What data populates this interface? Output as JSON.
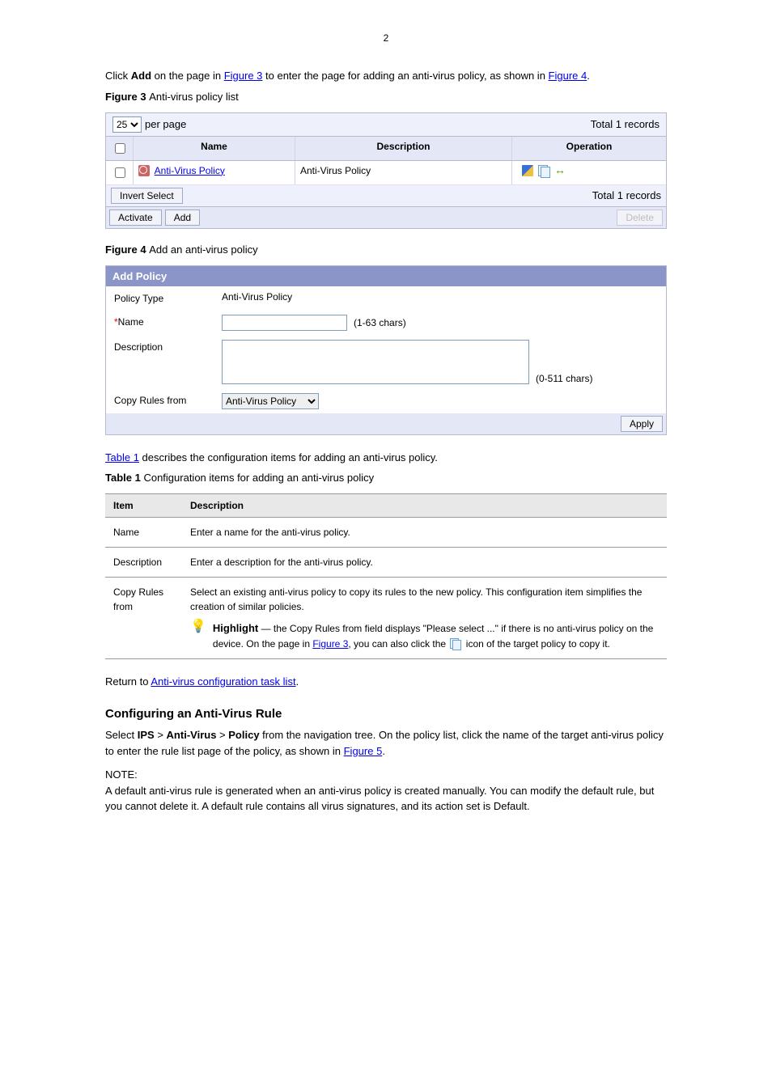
{
  "page_number": "2",
  "intro": {
    "line1_prefix": "Click ",
    "line1_bold": "Add",
    "line1_suffix": " on the page in ",
    "figure3_link": "Figure 3",
    "line1_end": " to enter the page for adding an anti-virus policy, as shown in ",
    "figure4_link_a": "Figure 4",
    "intro_end": "."
  },
  "fig3": {
    "caption_prefix": "Figure 3 ",
    "caption": "Anti-virus policy list",
    "perpage_value": "25",
    "perpage_label": "per page",
    "total_top": "Total 1 records",
    "th_name": "Name",
    "th_desc": "Description",
    "th_op": "Operation",
    "row_name": "Anti-Virus Policy",
    "row_desc": "Anti-Virus Policy",
    "invert_btn": "Invert Select",
    "total_bottom": "Total 1 records",
    "activate_btn": "Activate",
    "add_btn": "Add",
    "delete_btn": "Delete"
  },
  "fig4": {
    "caption_prefix": "Figure 4 ",
    "caption": "Add an anti-virus policy",
    "header": "Add Policy",
    "policy_type_label": "Policy Type",
    "policy_type_value": "Anti-Virus Policy",
    "name_label": "Name",
    "name_hint": "(1-63  chars)",
    "desc_label": "Description",
    "desc_hint": "(0-511  chars)",
    "copy_label": "Copy Rules from",
    "copy_value": "Anti-Virus Policy",
    "apply_btn": "Apply"
  },
  "tab1": {
    "caption_link": "Table 1",
    "caption_rest": " describes the configuration items for adding an anti-virus policy.",
    "full_caption_prefix": "Table 1 ",
    "full_caption": "Configuration items for adding an anti-virus policy",
    "th_item": "Item",
    "th_desc": "Description",
    "r1_item": "Name",
    "r1_desc": "Enter a name for the anti-virus policy.",
    "r2_item": "Description",
    "r2_desc": "Enter a description for the anti-virus policy.",
    "r3_item": "Copy Rules from",
    "r3_desc_line1": "Select an existing anti-virus policy to copy its rules to the new policy. This configuration item simplifies the creation of similar policies.",
    "highlight_label": "Highlight",
    "highlight_line_a": " — the Copy Rules from field displays \"Please select ...\" if there is no anti-virus policy on the device. On the page in ",
    "figure3_link": "Figure 3",
    "highlight_line_b": ", you can also click the ",
    "highlight_line_c": "icon of the target policy to copy it.",
    "footnote_prefix": "Return to ",
    "footnote_link": "Anti-virus configuration task list",
    "footnote_end": "."
  },
  "sect2": {
    "title": "Configuring an Anti-Virus Rule",
    "p1a": "Select ",
    "p1b": "IPS",
    "p1c": " > ",
    "p1d": "Anti-Virus",
    "p1e": " > ",
    "p1f": "Policy",
    "p1g": " from the navigation tree. On the policy list, click the name of the target anti-virus policy to enter the rule list page of the policy, as shown in ",
    "fig5_link": "Figure 5",
    "p1_end": ".",
    "note_label": "NOTE:",
    "note_body": "A default anti-virus rule is generated when an anti-virus policy is created manually. You can modify the default rule, but you cannot delete it. A default rule contains all virus signatures, and its action set is Default."
  }
}
